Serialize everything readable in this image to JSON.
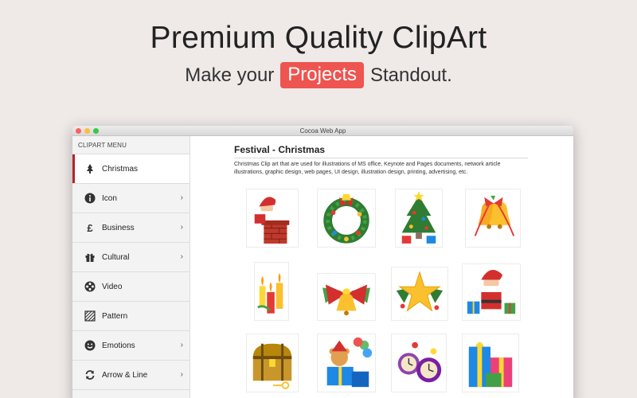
{
  "hero": {
    "title": "Premium Quality ClipArt",
    "tagline_prefix": "Make your",
    "tagline_highlight": "Projects",
    "tagline_suffix": "Standout."
  },
  "window": {
    "title": "Cocoa Web App"
  },
  "sidebar": {
    "header": "CLIPART MENU",
    "items": [
      {
        "label": "Christmas",
        "icon": "christmas-tree-icon",
        "active": true,
        "chevron": false
      },
      {
        "label": "Icon",
        "icon": "info-icon",
        "active": false,
        "chevron": true
      },
      {
        "label": "Business",
        "icon": "pound-icon",
        "active": false,
        "chevron": true
      },
      {
        "label": "Cultural",
        "icon": "gift-icon",
        "active": false,
        "chevron": true
      },
      {
        "label": "Video",
        "icon": "film-reel-icon",
        "active": false,
        "chevron": false
      },
      {
        "label": "Pattern",
        "icon": "pattern-icon",
        "active": false,
        "chevron": false
      },
      {
        "label": "Emotions",
        "icon": "smiley-icon",
        "active": false,
        "chevron": true
      },
      {
        "label": "Arrow & Line",
        "icon": "arrows-cycle-icon",
        "active": false,
        "chevron": true
      }
    ],
    "chevron_glyph": "›"
  },
  "content": {
    "title": "Festival - Christmas",
    "description": "Christmas Clip art that are used for illustrations of MS office, Keynote and Pages documents, network article illustrations, graphic design, web pages, UI design, illustration design, printing, advertising, etc.",
    "clips": [
      "santa-chimney-clipart",
      "christmas-wreath-clipart",
      "christmas-tree-clipart",
      "jingle-bells-clipart",
      "candles-clipart",
      "bow-bell-clipart",
      "golden-star-clipart",
      "santa-gifts-clipart",
      "treasure-chest-clipart",
      "teddy-gift-clipart",
      "ornament-clocks-clipart",
      "gift-boxes-clipart"
    ]
  },
  "colors": {
    "accent": "#ee5450",
    "active_marker": "#b1252b",
    "background": "#efe9e8"
  }
}
